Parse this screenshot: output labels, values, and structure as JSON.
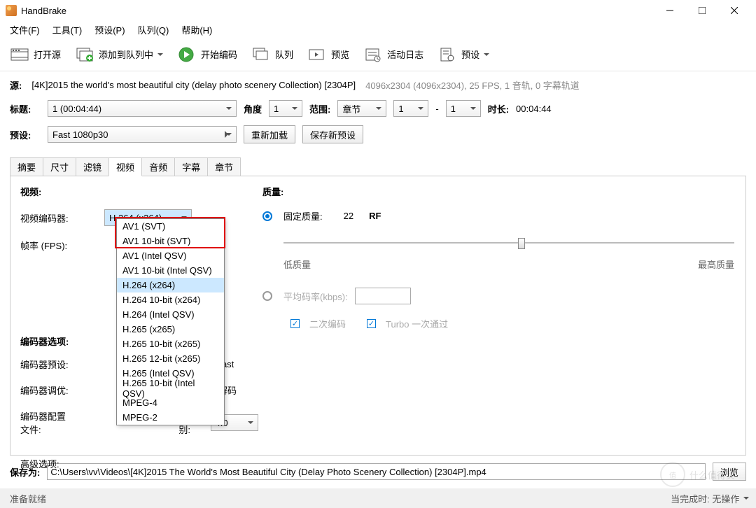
{
  "window": {
    "title": "HandBrake"
  },
  "menu": {
    "file": "文件(F)",
    "tools": "工具(T)",
    "presets": "预设(P)",
    "queue": "队列(Q)",
    "help": "帮助(H)"
  },
  "toolbar": {
    "open": "打开源",
    "addqueue": "添加到队列中",
    "start": "开始编码",
    "queue": "队列",
    "preview": "预览",
    "activity": "活动日志",
    "presets": "预设"
  },
  "source": {
    "label": "源:",
    "name": "[4K]2015 the world's most beautiful city (delay photo scenery Collection) [2304P]",
    "meta": "4096x2304 (4096x2304), 25 FPS, 1 音轨, 0 字幕轨道"
  },
  "title": {
    "label": "标题:",
    "value": "1  (00:04:44)",
    "angle_label": "角度",
    "angle": "1",
    "range_label": "范围:",
    "range_type": "章节",
    "from": "1",
    "dash": "-",
    "to": "1",
    "dur_label": "时长:",
    "dur": "00:04:44"
  },
  "preset": {
    "label": "预设:",
    "value": "Fast 1080p30",
    "reload": "重新加载",
    "save": "保存新预设"
  },
  "tabs": {
    "summary": "摘要",
    "dimensions": "尺寸",
    "filters": "滤镜",
    "video": "视频",
    "audio": "音频",
    "subtitles": "字幕",
    "chapters": "章节"
  },
  "video": {
    "section": "视频:",
    "encoder_label": "视频编码器:",
    "encoder": "H.264 (x264)",
    "fps_label": "帧率 (FPS):",
    "options": [
      "AV1 (SVT)",
      "AV1 10-bit (SVT)",
      "AV1 (Intel QSV)",
      "AV1 10-bit (Intel QSV)",
      "H.264 (x264)",
      "H.264 10-bit (x264)",
      "H.264 (Intel QSV)",
      "H.265 (x265)",
      "H.265 10-bit (x265)",
      "H.265 12-bit (x265)",
      "H.265 (Intel QSV)",
      "H.265 10-bit (Intel QSV)",
      "MPEG-4",
      "MPEG-2"
    ],
    "enc_opts_label": "编码器选项:",
    "enc_preset_label": "编码器预设:",
    "enc_preset_value": "Fast",
    "enc_tune_label": "编码器调优:",
    "enc_tune_suffix": "速解码",
    "enc_profile_label": "编码器配置文件:",
    "level_label": "级别:",
    "level": "4.0",
    "advanced_label": "高级选项:"
  },
  "quality": {
    "section": "质量:",
    "cq_label": "固定质量:",
    "cq_value": "22",
    "cq_unit": "RF",
    "low": "低质量",
    "high": "最高质量",
    "abr_label": "平均码率(kbps):",
    "twopass": "二次编码",
    "turbo": "Turbo 一次通过"
  },
  "save": {
    "label": "保存为:",
    "path": "C:\\Users\\vv\\Videos\\[4K]2015 The World's Most Beautiful City (Delay Photo Scenery Collection) [2304P].mp4",
    "browse": "浏览"
  },
  "status": {
    "ready": "准备就绪",
    "done": "当完成时:",
    "action": "无操作"
  },
  "watermark": "什么值得买"
}
